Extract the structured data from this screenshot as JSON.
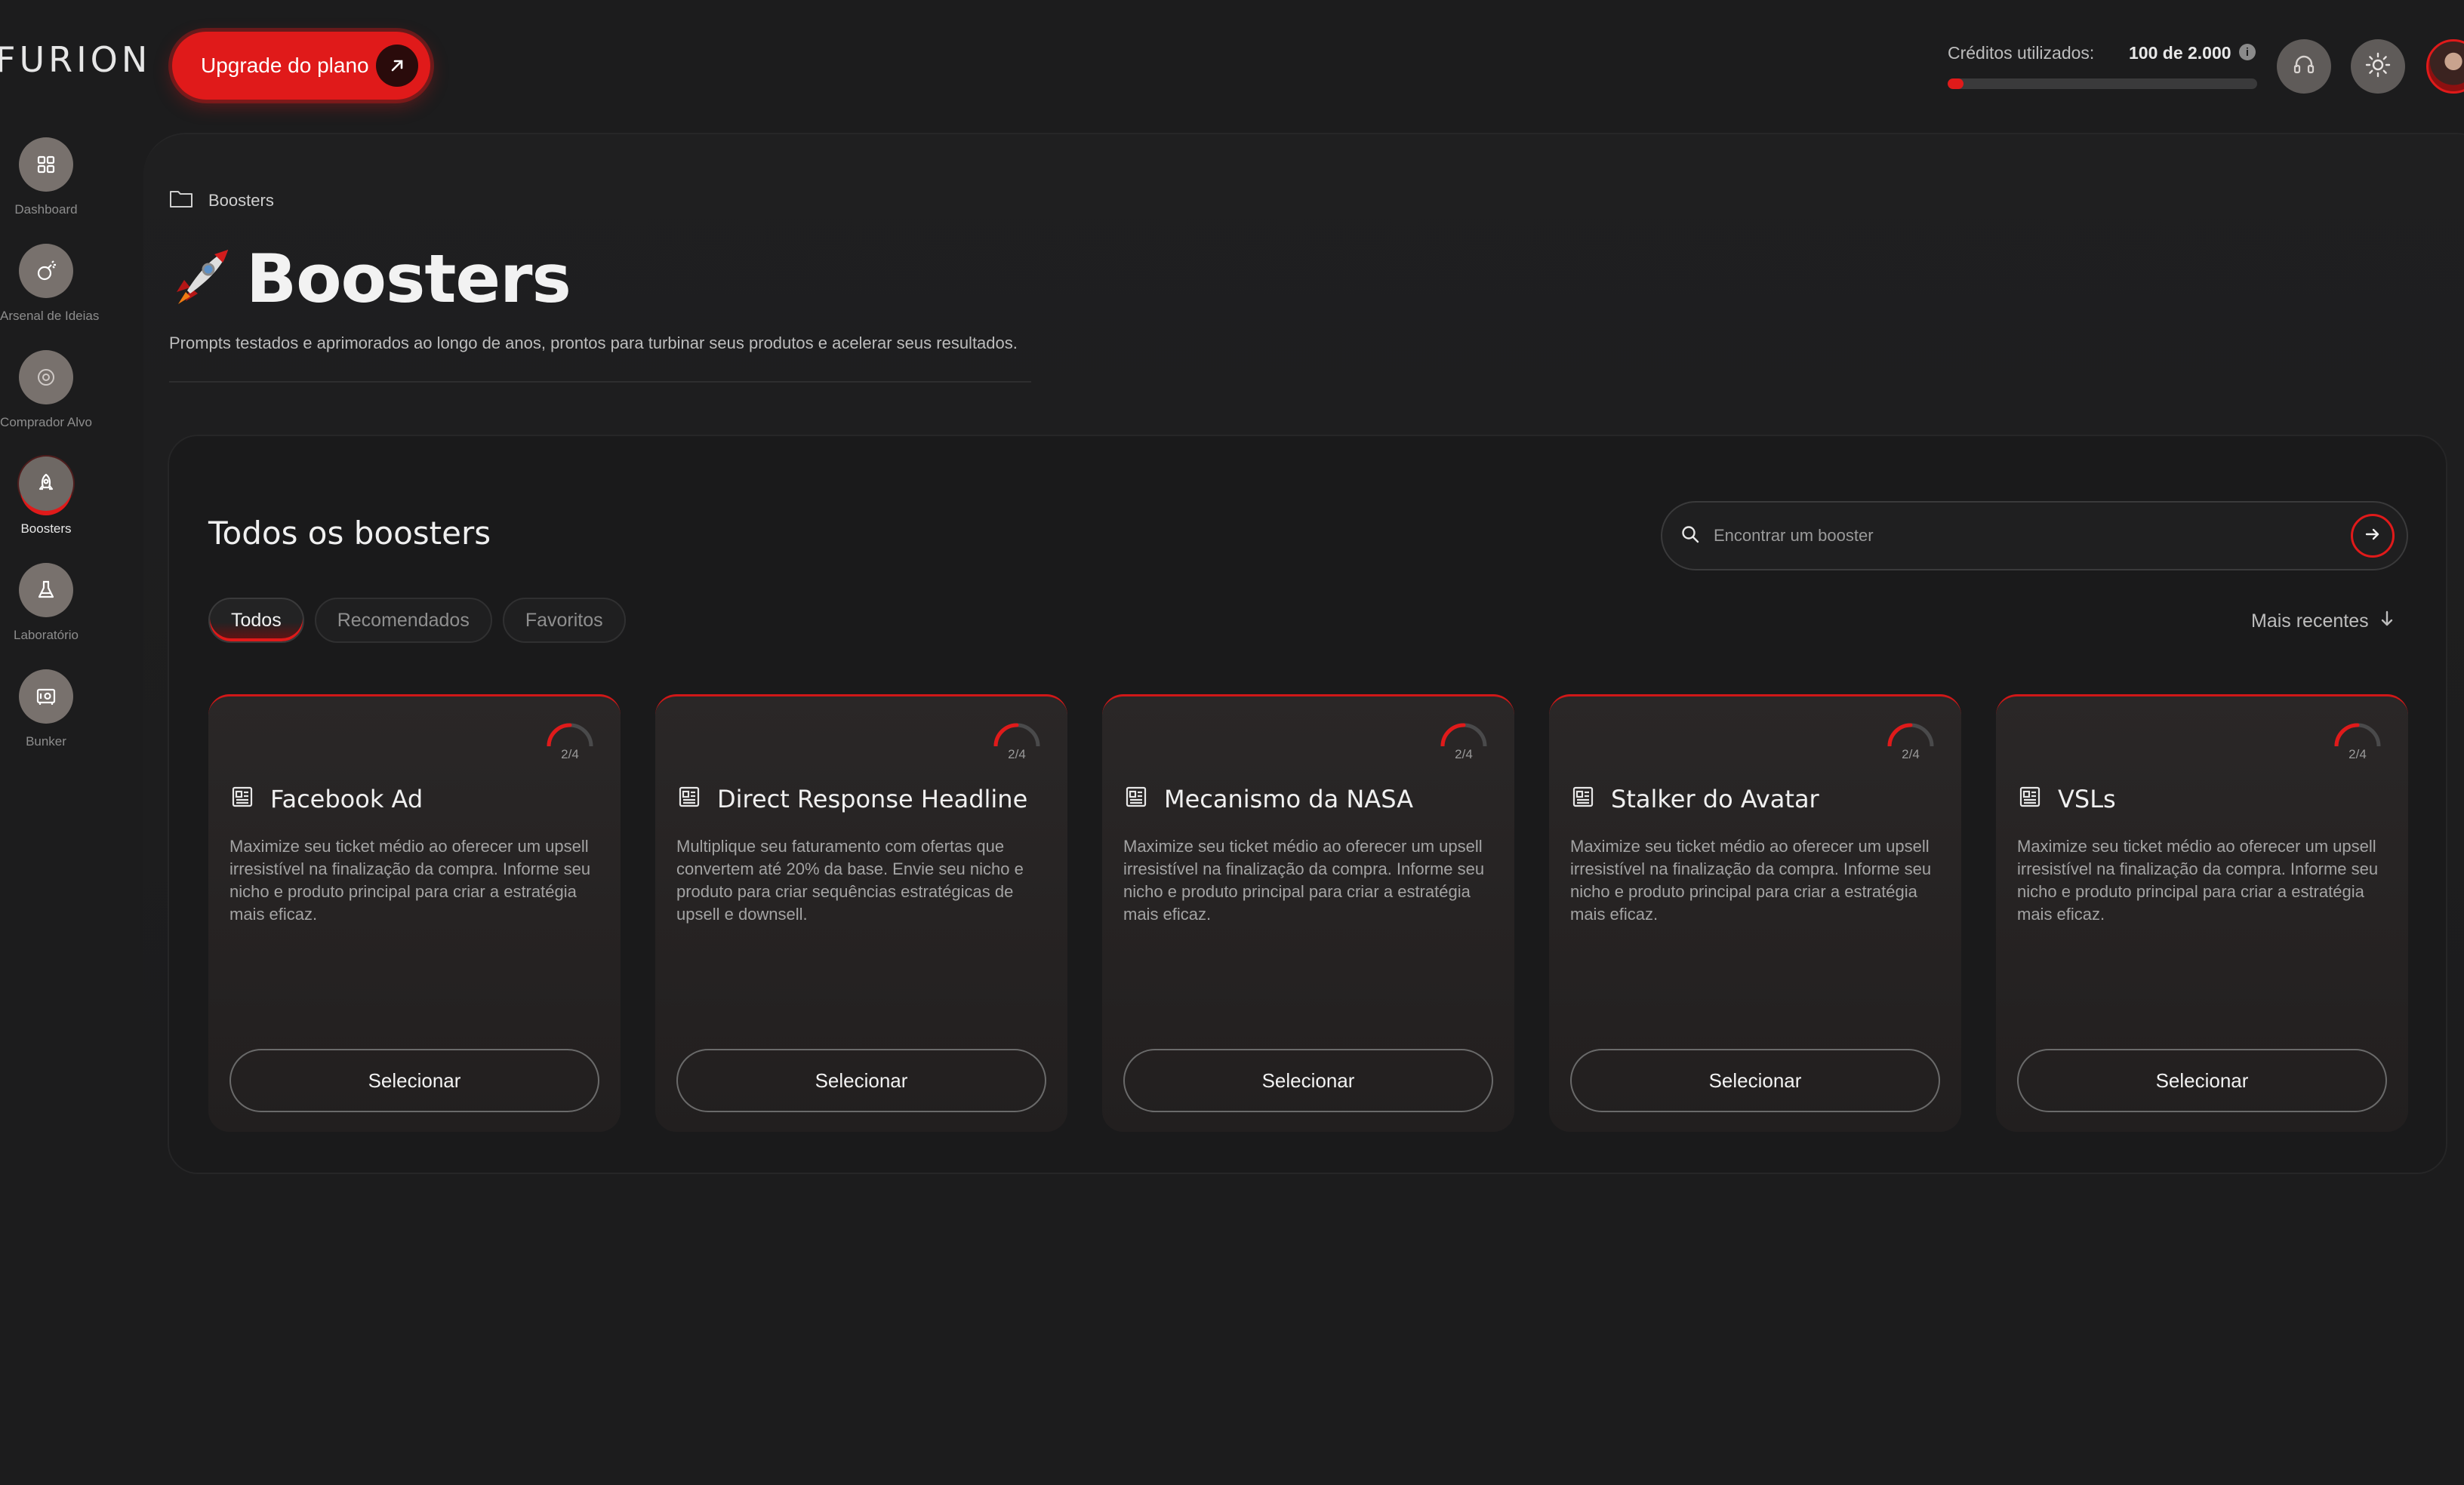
{
  "app": {
    "logo": "FURION"
  },
  "header": {
    "upgrade_label": "Upgrade do plano",
    "credits_label": "Créditos utilizados:",
    "credits_value": "100 de 2.000",
    "credits_fraction": 0.05,
    "info_icon": "info-icon",
    "support_icon": "headset-icon",
    "theme_icon": "sun-icon",
    "accent_color": "#e01a1a"
  },
  "sidebar": {
    "items": [
      {
        "label": "Dashboard",
        "icon": "grid-icon",
        "active": false
      },
      {
        "label": "Arsenal de Ideias",
        "icon": "bomb-icon",
        "active": false
      },
      {
        "label": "Comprador Alvo",
        "icon": "target-icon",
        "active": false
      },
      {
        "label": "Boosters",
        "icon": "rocket-icon",
        "active": true
      },
      {
        "label": "Laboratório",
        "icon": "flask-icon",
        "active": false
      },
      {
        "label": "Bunker",
        "icon": "safe-icon",
        "active": false
      }
    ]
  },
  "page": {
    "breadcrumb": "Boosters",
    "title": "Boosters",
    "subtitle": "Prompts testados e aprimorados ao longo de anos, prontos para turbinar  seus produtos e acelerar seus resultados."
  },
  "boosters": {
    "section_title": "Todos os boosters",
    "search_placeholder": "Encontrar um booster",
    "tabs": [
      "Todos",
      "Recomendados",
      "Favoritos"
    ],
    "active_tab": "Todos",
    "sort_label": "Mais recentes",
    "cards": [
      {
        "title": "Facebook Ad",
        "count": "2/4",
        "progress": 0.5,
        "description": "Maximize seu ticket médio ao oferecer um upsell irresistível na finalização da compra. Informe seu nicho e produto principal para criar a estratégia mais eficaz.",
        "button": "Selecionar"
      },
      {
        "title": "Direct Response Headline",
        "count": "2/4",
        "progress": 0.5,
        "description": "Multiplique seu faturamento com ofertas que convertem até 20% da base. Envie seu nicho e produto para criar sequências estratégicas de upsell e downsell.",
        "button": "Selecionar"
      },
      {
        "title": "Mecanismo da NASA",
        "count": "2/4",
        "progress": 0.5,
        "description": "Maximize seu ticket médio ao oferecer um upsell irresistível na finalização da compra. Informe seu nicho e produto principal para criar a estratégia mais eficaz.",
        "button": "Selecionar"
      },
      {
        "title": "Stalker do Avatar",
        "count": "2/4",
        "progress": 0.5,
        "description": "Maximize seu ticket médio ao oferecer um upsell irresistível na finalização da compra. Informe seu nicho e produto principal para criar a estratégia mais eficaz.",
        "button": "Selecionar"
      },
      {
        "title": "VSLs",
        "count": "2/4",
        "progress": 0.5,
        "description": "Maximize seu ticket médio ao oferecer um upsell irresistível na finalização da compra. Informe seu nicho e produto principal para criar a estratégia mais eficaz.",
        "button": "Selecionar"
      }
    ]
  }
}
